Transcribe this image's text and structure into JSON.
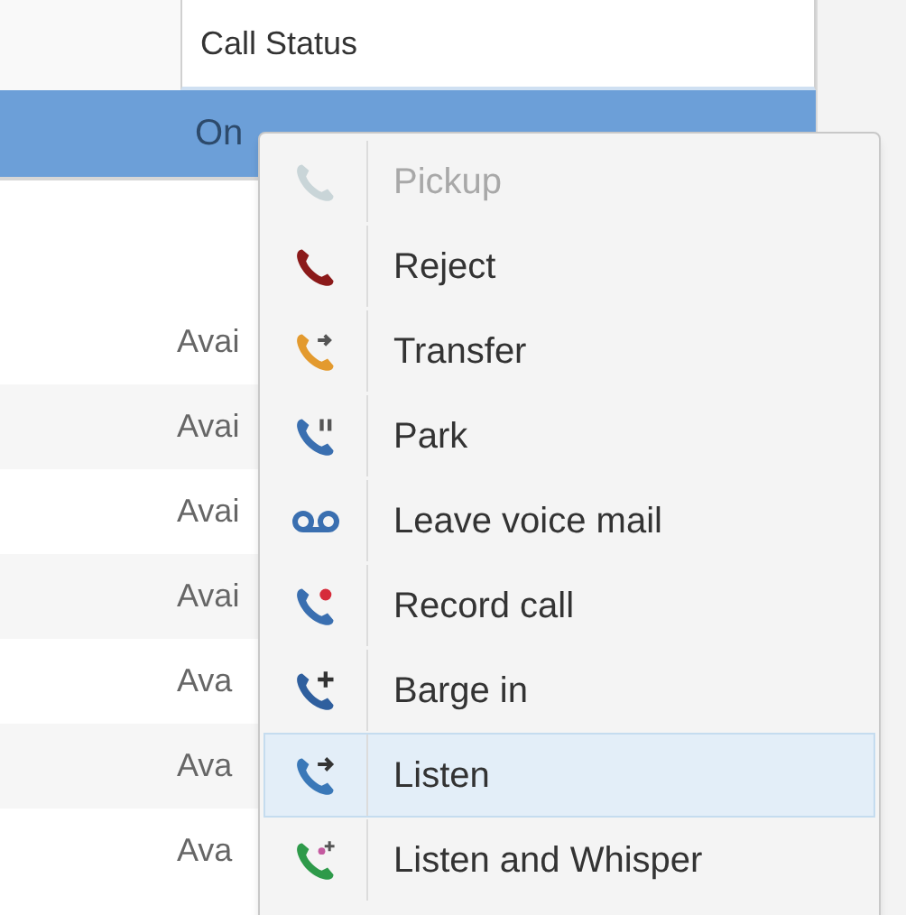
{
  "table": {
    "column_header": "Call Status",
    "rows": [
      {
        "cell": "On",
        "selected": true
      },
      {
        "cell": "Avai",
        "selected": false
      },
      {
        "cell": "Avai",
        "selected": false
      },
      {
        "cell": "Avai",
        "selected": false
      },
      {
        "cell": "Avai",
        "selected": false
      },
      {
        "cell": "Ava",
        "selected": false
      },
      {
        "cell": "Ava",
        "selected": false
      },
      {
        "cell": "Ava",
        "selected": false
      }
    ]
  },
  "context_menu": {
    "items": [
      {
        "label": "Pickup",
        "disabled": true,
        "selected": false
      },
      {
        "label": "Reject",
        "disabled": false,
        "selected": false
      },
      {
        "label": "Transfer",
        "disabled": false,
        "selected": false
      },
      {
        "label": "Park",
        "disabled": false,
        "selected": false
      },
      {
        "label": "Leave voice mail",
        "disabled": false,
        "selected": false
      },
      {
        "label": "Record call",
        "disabled": false,
        "selected": false
      },
      {
        "label": "Barge in",
        "disabled": false,
        "selected": false
      },
      {
        "label": "Listen",
        "disabled": false,
        "selected": true
      },
      {
        "label": "Listen and Whisper",
        "disabled": false,
        "selected": false
      }
    ]
  }
}
